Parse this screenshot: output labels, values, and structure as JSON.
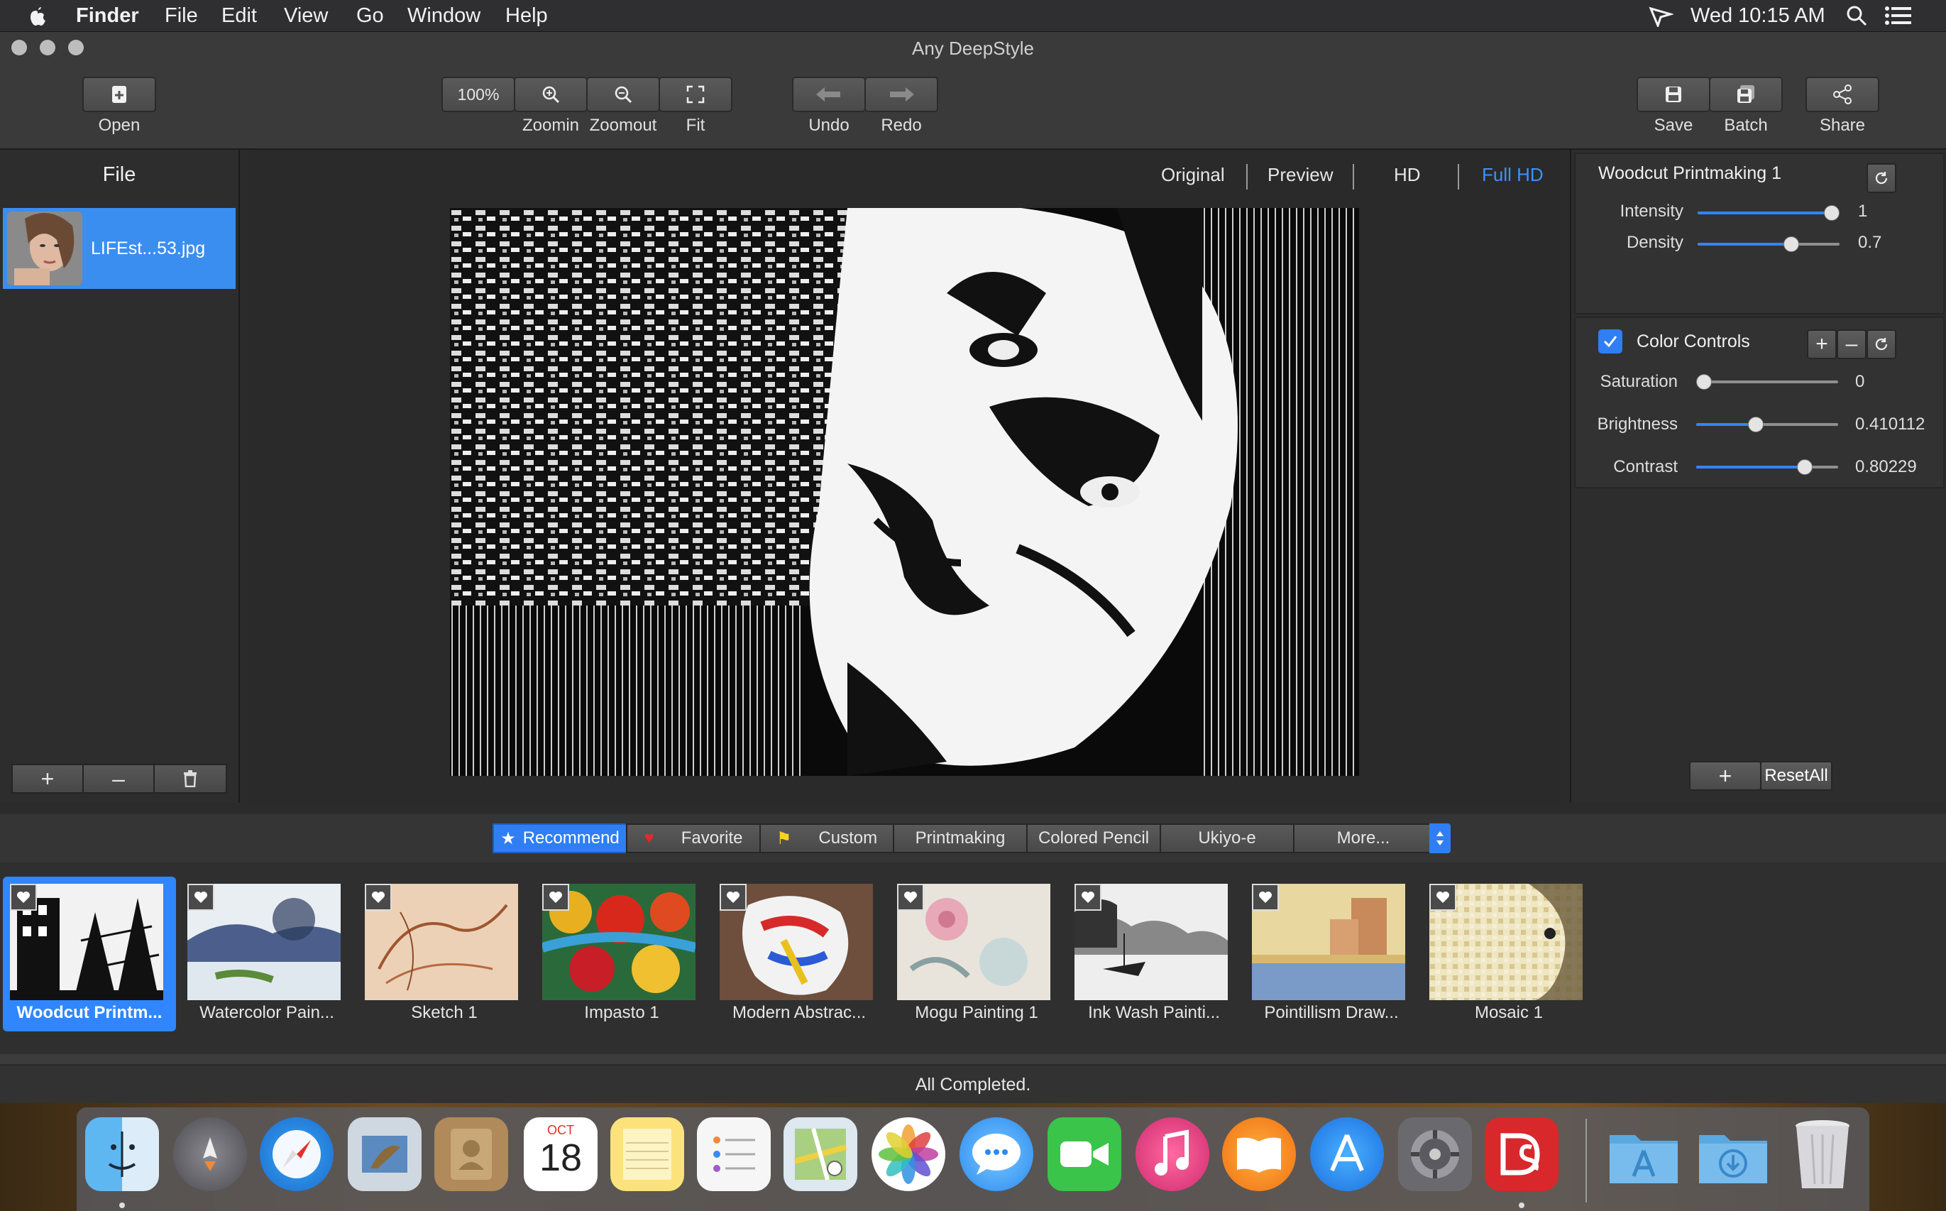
{
  "menubar": {
    "app": "Finder",
    "items": [
      "File",
      "Edit",
      "View",
      "Go",
      "Window",
      "Help"
    ],
    "clock": "Wed 10:15 AM"
  },
  "window": {
    "title": "Any DeepStyle"
  },
  "toolbar": {
    "open": "Open",
    "zoom_level": "100%",
    "zoomin": "Zoomin",
    "zoomout": "Zoomout",
    "fit": "Fit",
    "undo": "Undo",
    "redo": "Redo",
    "save": "Save",
    "batch": "Batch",
    "share": "Share"
  },
  "file_panel": {
    "header": "File",
    "files": [
      {
        "name": "LIFEst...53.jpg"
      }
    ]
  },
  "view_tabs": {
    "original": "Original",
    "preview": "Preview",
    "hd": "HD",
    "full_hd": "Full HD",
    "active": "Full HD"
  },
  "style_settings": {
    "title": "Woodcut Printmaking 1",
    "sliders": [
      {
        "label": "Intensity",
        "value": "1",
        "level": 1.0
      },
      {
        "label": "Density",
        "value": "0.7",
        "level": 0.68
      }
    ]
  },
  "color_controls": {
    "title": "Color Controls",
    "checked": true,
    "sliders": [
      {
        "label": "Saturation",
        "value": "0",
        "level": 0.0
      },
      {
        "label": "Brightness",
        "value": "0.410112",
        "level": 0.41
      },
      {
        "label": "Contrast",
        "value": "0.80229",
        "level": 0.8
      }
    ]
  },
  "reset_all": "ResetAll",
  "style_tabs": {
    "recommend": "Recommend",
    "favorite": "Favorite",
    "custom": "Custom",
    "printmaking": "Printmaking",
    "colored_pencil": "Colored Pencil",
    "ukiyoe": "Ukiyo-e",
    "more": "More..."
  },
  "styles": [
    {
      "label": "Woodcut Printm...",
      "selected": true
    },
    {
      "label": "Watercolor Pain..."
    },
    {
      "label": "Sketch 1"
    },
    {
      "label": "Impasto 1"
    },
    {
      "label": "Modern Abstrac..."
    },
    {
      "label": "Mogu Painting 1"
    },
    {
      "label": "Ink Wash Painti..."
    },
    {
      "label": "Pointillism Draw..."
    },
    {
      "label": "Mosaic 1"
    }
  ],
  "status": "All Completed.",
  "dock": {
    "calendar_month": "OCT",
    "calendar_day": "18"
  },
  "colors": {
    "accent": "#2f86ff",
    "panel": "#2d2d2d",
    "toolbar": "#3a3a3a"
  }
}
